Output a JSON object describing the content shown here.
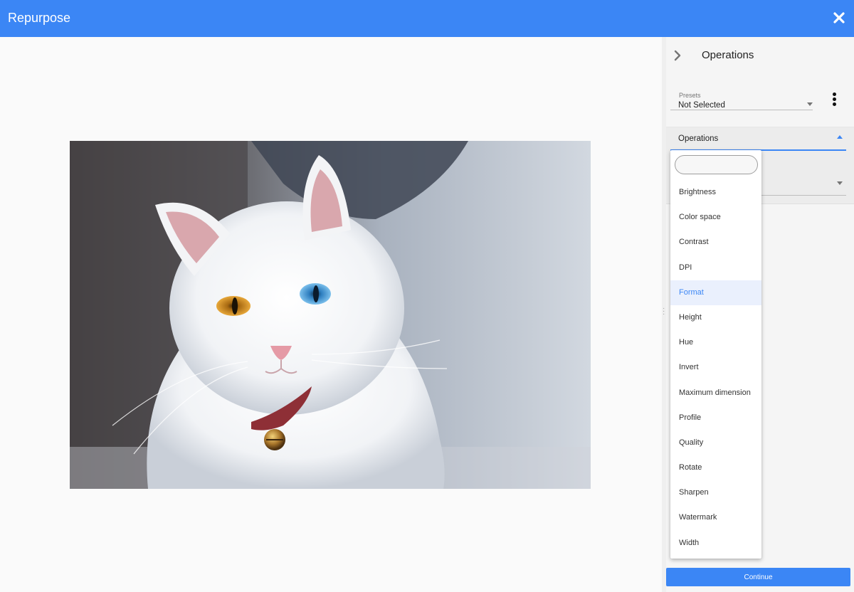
{
  "app": {
    "title": "Repurpose",
    "close_icon": "close-icon"
  },
  "colors": {
    "accent": "#3b86f5",
    "selected_bg": "#eaf0fd"
  },
  "panel": {
    "title": "Operations",
    "collapse_icon": "chevron-right-icon",
    "presets": {
      "label": "Presets",
      "value": "Not Selected",
      "more_icon": "more-vertical-icon"
    },
    "operations_select": {
      "label": "Operations",
      "expanded": true
    },
    "continue_label": "Continue"
  },
  "dropdown": {
    "search_placeholder": "",
    "selected": "Format",
    "items": [
      "Brightness",
      "Color space",
      "Contrast",
      "DPI",
      "Format",
      "Height",
      "Hue",
      "Invert",
      "Maximum dimension",
      "Profile",
      "Quality",
      "Rotate",
      "Sharpen",
      "Watermark",
      "Width"
    ]
  },
  "preview": {
    "subject": "white long-haired cat with odd eyes wearing a red collar with a bell"
  }
}
